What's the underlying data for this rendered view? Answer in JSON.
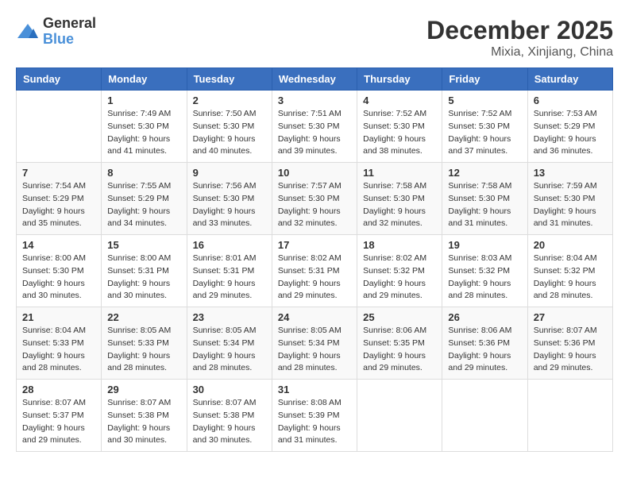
{
  "logo": {
    "line1": "General",
    "line2": "Blue"
  },
  "title": "December 2025",
  "location": "Mixia, Xinjiang, China",
  "weekdays": [
    "Sunday",
    "Monday",
    "Tuesday",
    "Wednesday",
    "Thursday",
    "Friday",
    "Saturday"
  ],
  "weeks": [
    [
      {
        "day": "",
        "info": ""
      },
      {
        "day": "1",
        "info": "Sunrise: 7:49 AM\nSunset: 5:30 PM\nDaylight: 9 hours\nand 41 minutes."
      },
      {
        "day": "2",
        "info": "Sunrise: 7:50 AM\nSunset: 5:30 PM\nDaylight: 9 hours\nand 40 minutes."
      },
      {
        "day": "3",
        "info": "Sunrise: 7:51 AM\nSunset: 5:30 PM\nDaylight: 9 hours\nand 39 minutes."
      },
      {
        "day": "4",
        "info": "Sunrise: 7:52 AM\nSunset: 5:30 PM\nDaylight: 9 hours\nand 38 minutes."
      },
      {
        "day": "5",
        "info": "Sunrise: 7:52 AM\nSunset: 5:30 PM\nDaylight: 9 hours\nand 37 minutes."
      },
      {
        "day": "6",
        "info": "Sunrise: 7:53 AM\nSunset: 5:29 PM\nDaylight: 9 hours\nand 36 minutes."
      }
    ],
    [
      {
        "day": "7",
        "info": "Sunrise: 7:54 AM\nSunset: 5:29 PM\nDaylight: 9 hours\nand 35 minutes."
      },
      {
        "day": "8",
        "info": "Sunrise: 7:55 AM\nSunset: 5:29 PM\nDaylight: 9 hours\nand 34 minutes."
      },
      {
        "day": "9",
        "info": "Sunrise: 7:56 AM\nSunset: 5:30 PM\nDaylight: 9 hours\nand 33 minutes."
      },
      {
        "day": "10",
        "info": "Sunrise: 7:57 AM\nSunset: 5:30 PM\nDaylight: 9 hours\nand 32 minutes."
      },
      {
        "day": "11",
        "info": "Sunrise: 7:58 AM\nSunset: 5:30 PM\nDaylight: 9 hours\nand 32 minutes."
      },
      {
        "day": "12",
        "info": "Sunrise: 7:58 AM\nSunset: 5:30 PM\nDaylight: 9 hours\nand 31 minutes."
      },
      {
        "day": "13",
        "info": "Sunrise: 7:59 AM\nSunset: 5:30 PM\nDaylight: 9 hours\nand 31 minutes."
      }
    ],
    [
      {
        "day": "14",
        "info": "Sunrise: 8:00 AM\nSunset: 5:30 PM\nDaylight: 9 hours\nand 30 minutes."
      },
      {
        "day": "15",
        "info": "Sunrise: 8:00 AM\nSunset: 5:31 PM\nDaylight: 9 hours\nand 30 minutes."
      },
      {
        "day": "16",
        "info": "Sunrise: 8:01 AM\nSunset: 5:31 PM\nDaylight: 9 hours\nand 29 minutes."
      },
      {
        "day": "17",
        "info": "Sunrise: 8:02 AM\nSunset: 5:31 PM\nDaylight: 9 hours\nand 29 minutes."
      },
      {
        "day": "18",
        "info": "Sunrise: 8:02 AM\nSunset: 5:32 PM\nDaylight: 9 hours\nand 29 minutes."
      },
      {
        "day": "19",
        "info": "Sunrise: 8:03 AM\nSunset: 5:32 PM\nDaylight: 9 hours\nand 28 minutes."
      },
      {
        "day": "20",
        "info": "Sunrise: 8:04 AM\nSunset: 5:32 PM\nDaylight: 9 hours\nand 28 minutes."
      }
    ],
    [
      {
        "day": "21",
        "info": "Sunrise: 8:04 AM\nSunset: 5:33 PM\nDaylight: 9 hours\nand 28 minutes."
      },
      {
        "day": "22",
        "info": "Sunrise: 8:05 AM\nSunset: 5:33 PM\nDaylight: 9 hours\nand 28 minutes."
      },
      {
        "day": "23",
        "info": "Sunrise: 8:05 AM\nSunset: 5:34 PM\nDaylight: 9 hours\nand 28 minutes."
      },
      {
        "day": "24",
        "info": "Sunrise: 8:05 AM\nSunset: 5:34 PM\nDaylight: 9 hours\nand 28 minutes."
      },
      {
        "day": "25",
        "info": "Sunrise: 8:06 AM\nSunset: 5:35 PM\nDaylight: 9 hours\nand 29 minutes."
      },
      {
        "day": "26",
        "info": "Sunrise: 8:06 AM\nSunset: 5:36 PM\nDaylight: 9 hours\nand 29 minutes."
      },
      {
        "day": "27",
        "info": "Sunrise: 8:07 AM\nSunset: 5:36 PM\nDaylight: 9 hours\nand 29 minutes."
      }
    ],
    [
      {
        "day": "28",
        "info": "Sunrise: 8:07 AM\nSunset: 5:37 PM\nDaylight: 9 hours\nand 29 minutes."
      },
      {
        "day": "29",
        "info": "Sunrise: 8:07 AM\nSunset: 5:38 PM\nDaylight: 9 hours\nand 30 minutes."
      },
      {
        "day": "30",
        "info": "Sunrise: 8:07 AM\nSunset: 5:38 PM\nDaylight: 9 hours\nand 30 minutes."
      },
      {
        "day": "31",
        "info": "Sunrise: 8:08 AM\nSunset: 5:39 PM\nDaylight: 9 hours\nand 31 minutes."
      },
      {
        "day": "",
        "info": ""
      },
      {
        "day": "",
        "info": ""
      },
      {
        "day": "",
        "info": ""
      }
    ]
  ]
}
